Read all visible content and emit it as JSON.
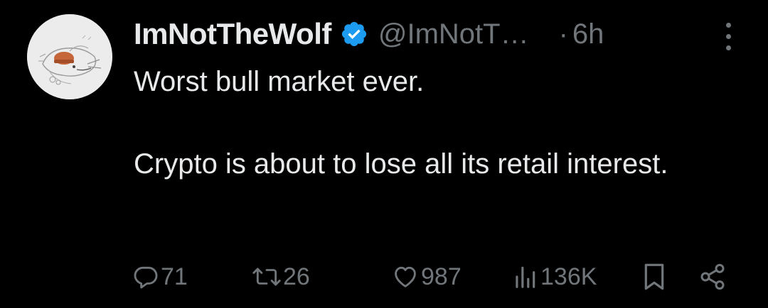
{
  "author": {
    "display_name": "ImNotTheWolf",
    "handle": "@ImNotT…",
    "verified_icon": "verified-badge-icon",
    "avatar_icon": "hand-drawn-wolf-avatar"
  },
  "meta": {
    "separator": "·",
    "time": "6h",
    "more_icon": "more-vertical-icon"
  },
  "tweet": {
    "lines": [
      "Worst bull market ever.",
      "",
      "Crypto is about to lose all its retail interest."
    ]
  },
  "actions": {
    "reply": {
      "icon": "reply-icon",
      "count": "71"
    },
    "retweet": {
      "icon": "retweet-icon",
      "count": "26"
    },
    "like": {
      "icon": "heart-icon",
      "count": "987"
    },
    "views": {
      "icon": "views-icon",
      "count": "136K"
    },
    "bookmark": {
      "icon": "bookmark-icon"
    },
    "share": {
      "icon": "share-icon"
    }
  },
  "colors": {
    "background": "#000000",
    "primary_text": "#e7e9ea",
    "secondary_text": "#71767b",
    "verified": "#1d9bf0"
  }
}
